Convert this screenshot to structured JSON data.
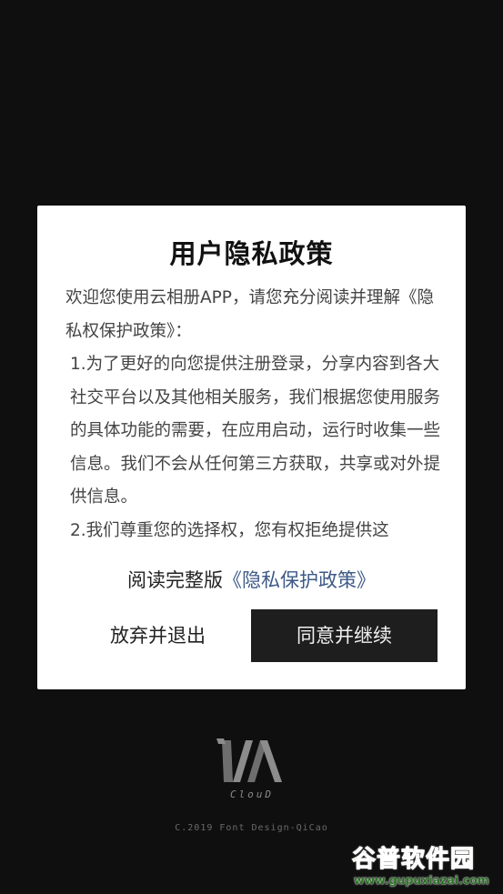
{
  "dialog": {
    "title": "用户隐私政策",
    "body": [
      "欢迎您使用云相册APP，请您充分阅读并理解《隐私权保护政策》：",
      "1.为了更好的向您提供注册登录，分享内容到各大社交平台以及其他相关服务，我们根据您使用服务的具体功能的需要，在应用启动，运行时收集一些信息。我们不会从任何第三方获取，共享或对外提供信息。",
      "2.我们尊重您的选择权，您有权拒绝提供这"
    ],
    "full_text_prefix": "阅读完整版",
    "full_text_link": "《隐私保护政策》",
    "cancel_label": "放弃并退出",
    "agree_label": "同意并继续"
  },
  "branding": {
    "logo_text": "ClouD",
    "credit": "C.2019 Font Design-QiCao"
  },
  "watermark": {
    "title": "谷普软件园",
    "url": "www.gupuxiazai.com"
  },
  "colors": {
    "background": "#0f0f10",
    "dialog_bg": "#ffffff",
    "link": "#3d5a87",
    "agree_button_bg": "#1e1e1e"
  }
}
